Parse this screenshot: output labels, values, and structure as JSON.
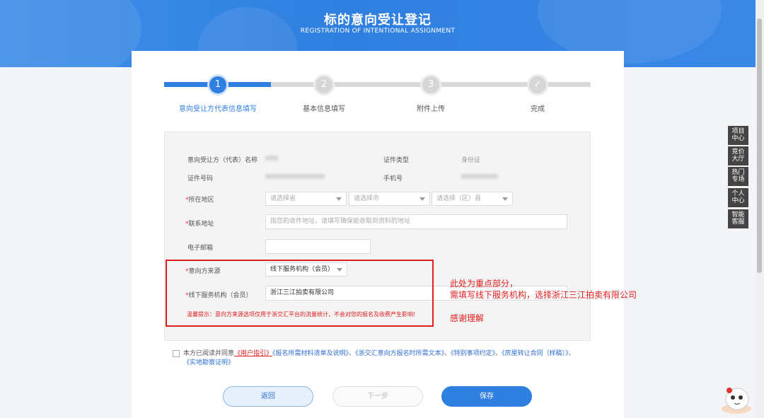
{
  "header": {
    "title": "标的意向受让登记",
    "subtitle": "REGISTRATION OF INTENTIONAL ASSIGNMENT"
  },
  "steps": [
    {
      "number": "1",
      "label": "意向受让方代表信息填写",
      "state": "active"
    },
    {
      "number": "2",
      "label": "基本信息填写",
      "state": "pending"
    },
    {
      "number": "3",
      "label": "附件上传",
      "state": "pending"
    },
    {
      "number": "✓",
      "label": "完成",
      "state": "pending"
    }
  ],
  "form": {
    "name_label": "意向受让方（代表）名称",
    "id_type_label": "证件类型",
    "id_type_value": "身份证",
    "id_number_label": "证件号码",
    "phone_label": "手机号",
    "region_label": "所在地区",
    "province_placeholder": "请选择省",
    "city_placeholder": "请选择市",
    "district_placeholder": "请选择（区）县",
    "address_label": "联系地址",
    "address_placeholder": "指您的收件地址，请填写确保能收取到资料的地址",
    "email_label": "电子邮箱",
    "source_label": "意向方来源",
    "source_value": "线下服务机构（会员）",
    "agency_label": "线下服务机构（会员）",
    "agency_value": "浙江三江拍卖有限公司",
    "tip": "温馨提示：意向方来源选项仅用于浙交汇平台的流量统计，不会对您的报名及收费产生影响!"
  },
  "annotation": {
    "line1": "此处为重点部分，",
    "line2": "需填写线下服务机构，选择浙江三江拍卖有限公司",
    "line3": "感谢理解"
  },
  "agreement": {
    "prefix": "本方已阅读并同意",
    "link_guide": "《用户指引》",
    "link_list": "《报名所需材料清单及说明》",
    "sep": "、",
    "link_text": "《浙交汇意向方报名时所需文本》",
    "link_special": "《特别事项约定》",
    "link_contract": "《房屋转让合同（样稿）》",
    "link_survey": "《实地勘察证明》"
  },
  "buttons": {
    "back": "返回",
    "next": "下一步",
    "save": "保存"
  },
  "sidebar": [
    {
      "label": "项目中心"
    },
    {
      "label": "竞价大厅"
    },
    {
      "label": "热门专场"
    },
    {
      "label": "个人中心"
    },
    {
      "label": "智能客服"
    }
  ],
  "colors": {
    "primary": "#2f7fe0",
    "annotation": "#e01e1e",
    "sidebar": "#444444"
  }
}
